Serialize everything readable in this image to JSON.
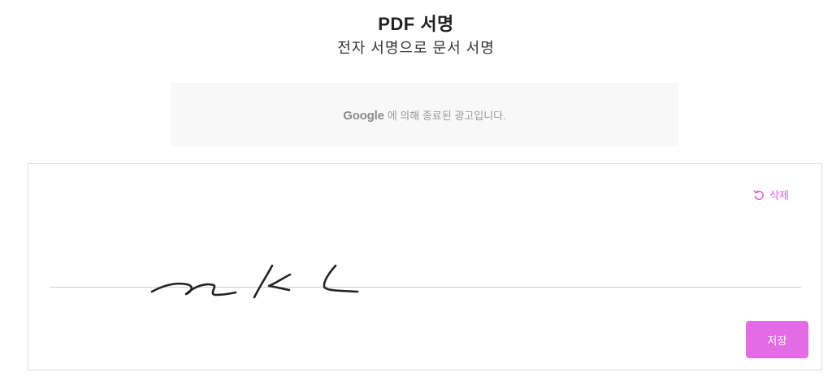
{
  "header": {
    "title": "PDF 서명",
    "subtitle": "전자 서명으로 문서 서명"
  },
  "ad": {
    "brand": "Google",
    "message": "에 의해 종료된 광고입니다."
  },
  "signature_panel": {
    "clear_label": "삭제",
    "save_label": "저장"
  },
  "colors": {
    "accent": "#e56be5",
    "accent_text": "#e05ce0",
    "ad_background": "#f8f8f8"
  },
  "icons": {
    "clear": "rotate-ccw-icon"
  }
}
